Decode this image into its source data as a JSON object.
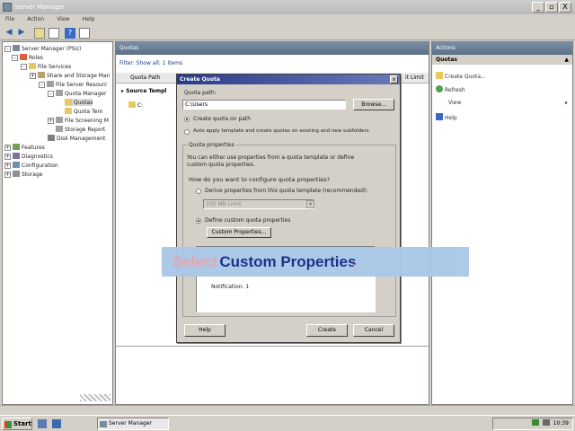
{
  "window": {
    "title": "Server Manager",
    "minimize": "_",
    "restore": "▫",
    "close": "X"
  },
  "menu": [
    "File",
    "Action",
    "View",
    "Help"
  ],
  "tree": [
    {
      "label": "Server Manager (PSU)",
      "level": 0,
      "exp": "-"
    },
    {
      "label": "Roles",
      "level": 1,
      "exp": "-"
    },
    {
      "label": "File Services",
      "level": 2,
      "exp": "-"
    },
    {
      "label": "Share and Storage Man",
      "level": 3,
      "exp": "+"
    },
    {
      "label": "File Server Resourc",
      "level": 3,
      "exp": "-"
    },
    {
      "label": "Quota Manager",
      "level": 4,
      "exp": "-"
    },
    {
      "label": "Quotas",
      "level": 5,
      "exp": ""
    },
    {
      "label": "Quota Tem",
      "level": 5,
      "exp": ""
    },
    {
      "label": "File Screening M",
      "level": 4,
      "exp": "+"
    },
    {
      "label": "Storage Report",
      "level": 4,
      "exp": ""
    },
    {
      "label": "Disk Management",
      "level": 3,
      "exp": ""
    },
    {
      "label": "Features",
      "level": 0,
      "exp": "+"
    },
    {
      "label": "Diagnostics",
      "level": 0,
      "exp": "+"
    },
    {
      "label": "Configuration",
      "level": 0,
      "exp": "+"
    },
    {
      "label": "Storage",
      "level": 0,
      "exp": "+"
    }
  ],
  "center": {
    "header": "Quotas",
    "filter": "Filter: Show all: 1 items",
    "col_quota_path": "Quota Path",
    "col_limit": "it Limit",
    "group_row": "Source Templ",
    "row": "C:"
  },
  "actions": {
    "header": "Actions",
    "section": "Quotas",
    "items": [
      {
        "label": "Create Quota...",
        "icon": "create-icon"
      },
      {
        "label": "Refresh",
        "icon": "refresh-icon"
      },
      {
        "label": "View",
        "icon": ""
      },
      {
        "label": "Help",
        "icon": "help-icon"
      }
    ]
  },
  "dialog": {
    "title": "Create Quota",
    "quota_path_label": "Quota path:",
    "quota_path_value": "C:\\Users",
    "browse": "Browse...",
    "opt_create_on_path": "Create quota on path",
    "opt_auto_apply": "Auto apply template and create quotas on existing and new subfolders",
    "group_title": "Quota properties",
    "group_desc": "You can either use properties from a quota template or define custom quota properties.",
    "how_label": "How do you want to configure quota properties?",
    "opt_derive": "Derive properties from this quota template (recommended):",
    "template_value": "100 MB Limit",
    "opt_custom": "Define custom quota properties",
    "custom_btn": "Custom Properties...",
    "summary": "Notification: 1",
    "help": "Help",
    "create": "Create",
    "cancel": "Cancel"
  },
  "banner": {
    "word1": "Select",
    "word2": "Custom Properties",
    "word3": ".",
    "color1": "#f0a0a8",
    "color2": "#1a2a8a"
  },
  "taskbar": {
    "start": "Start",
    "task": "Server Manager",
    "clock": "10:39"
  }
}
